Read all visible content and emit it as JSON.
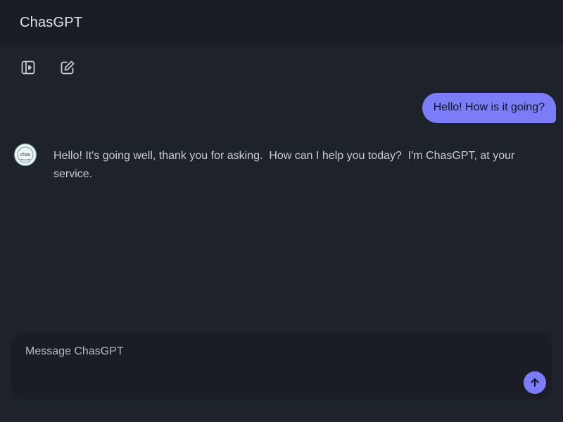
{
  "header": {
    "title": "ChasGPT"
  },
  "toolbar": {
    "sidebar_toggle_icon": "sidebar-toggle-icon",
    "new_chat_icon": "edit-icon"
  },
  "conversation": {
    "messages": [
      {
        "role": "user",
        "text": "Hello! How is it going?"
      },
      {
        "role": "assistant",
        "text": "Hello! It's going well, thank you for asking.  How can I help you today?  I'm ChasGPT, at your service."
      }
    ]
  },
  "avatar": {
    "text": "chas"
  },
  "composer": {
    "placeholder": "Message ChasGPT",
    "send_icon": "arrow-up-icon"
  },
  "colors": {
    "background": "#1e222a",
    "header": "#1a1d24",
    "accent": "#7b7cf7",
    "text": "#c9ccd2"
  }
}
